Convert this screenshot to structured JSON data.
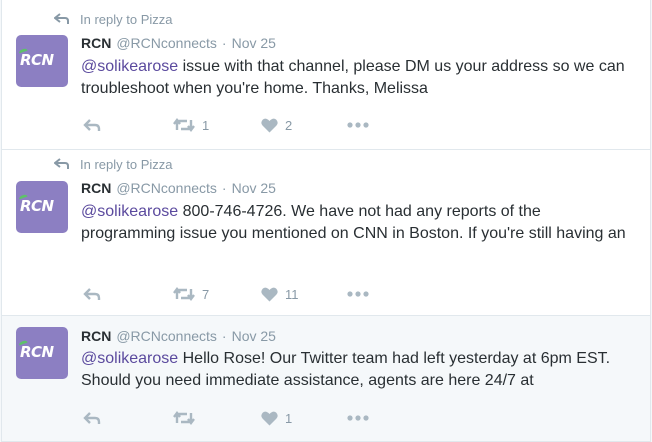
{
  "tweets": [
    {
      "reply_context": "In reply to Pizza",
      "author_name": "RCN",
      "handle": "@RCNconnects",
      "separator": "·",
      "time": "Nov 25",
      "avatar_text": "RCN",
      "mention": "@solikearose",
      "body": " issue with that channel, please DM us your address so we can troubleshoot when you're home. Thanks, Melissa",
      "retweet_count": "1",
      "like_count": "2"
    },
    {
      "reply_context": "In reply to Pizza",
      "author_name": "RCN",
      "handle": "@RCNconnects",
      "separator": "·",
      "time": "Nov 25",
      "avatar_text": "RCN",
      "mention": "@solikearose",
      "body": " 800-746-4726. We have not had any reports of the programming issue you mentioned on CNN in Boston. If you're still having an",
      "retweet_count": "7",
      "like_count": "11"
    },
    {
      "author_name": "RCN",
      "handle": "@RCNconnects",
      "separator": "·",
      "time": "Nov 25",
      "avatar_text": "RCN",
      "mention": "@solikearose",
      "body": " Hello Rose! Our Twitter team had left yesterday at 6pm EST. Should you need immediate assistance, agents are here 24/7 at",
      "retweet_count": "",
      "like_count": "1"
    }
  ],
  "icons": {
    "reply": "reply-arrow-icon",
    "retweet": "retweet-icon",
    "like": "heart-icon",
    "more": "more-dots-icon"
  },
  "colors": {
    "mention": "#5b4a9e",
    "muted": "#8899a6",
    "icon": "#aab8c2",
    "avatar_bg": "#8c7fc2",
    "logo_swoosh": "#5ec16a"
  }
}
